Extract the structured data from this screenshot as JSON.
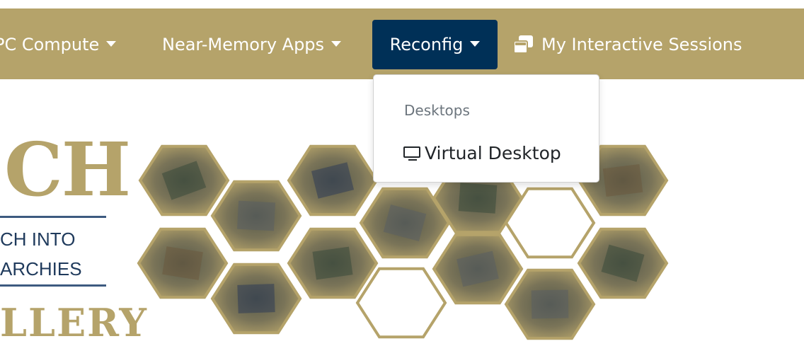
{
  "navbar": {
    "items": [
      {
        "label": "PC Compute"
      },
      {
        "label": "Near-Memory Apps"
      },
      {
        "label": "Reconfig"
      },
      {
        "label": "My Interactive Sessions"
      }
    ]
  },
  "dropdown": {
    "header": "Desktops",
    "items": [
      {
        "label": "Virtual Desktop"
      }
    ]
  },
  "logo": {
    "letters": "CH",
    "line1": "CH INTO",
    "line2": "ARCHIES",
    "word": "LLERY"
  },
  "colors": {
    "navbar": "#b5a36a",
    "active": "#003057",
    "gold": "#b5a36a",
    "navy": "#1f3a5c"
  }
}
